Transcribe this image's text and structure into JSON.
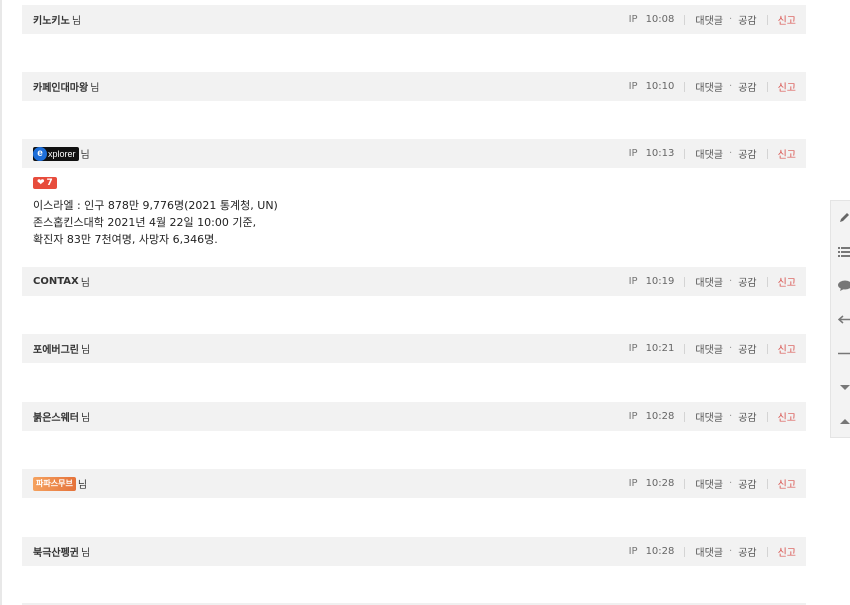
{
  "nim_suffix": "님",
  "actions": {
    "ip_label": "IP",
    "reply_label": "대댓글",
    "like_label": "공감",
    "report_label": "신고",
    "separator_dot": "·"
  },
  "comments": [
    {
      "author": "키노키노",
      "time": "10:08"
    },
    {
      "author": "카페인대마왕",
      "time": "10:10"
    },
    {
      "author_badge": "xplorer",
      "time": "10:13",
      "likes": "7",
      "body": [
        "이스라엘 : 인구 878만 9,776명(2021 통계청, UN)",
        "존스홉킨스대학 2021년 4월 22일 10:00 기준,",
        "확진자 83만 7천여명, 사망자 6,346명."
      ]
    },
    {
      "author": "CONTAX",
      "time": "10:19"
    },
    {
      "author": "포에버그린",
      "time": "10:21"
    },
    {
      "author": "붉은스웨터",
      "time": "10:28"
    },
    {
      "author_badge": "파파스무브",
      "time": "10:28"
    },
    {
      "author": "북극산펭귄",
      "time": "10:28"
    }
  ],
  "icons": {
    "ie_logo": "ie-logo-icon",
    "heart": "heart-icon",
    "toolbar": [
      "pencil-icon",
      "list-icon",
      "comment-icon",
      "back-arrow-icon",
      "dash-icon",
      "chevron-down-icon",
      "chevron-up-icon"
    ]
  },
  "colors": {
    "header_bg": "#f2f2f2",
    "report_red": "#d9534f",
    "like_badge_red": "#e74c3c"
  }
}
